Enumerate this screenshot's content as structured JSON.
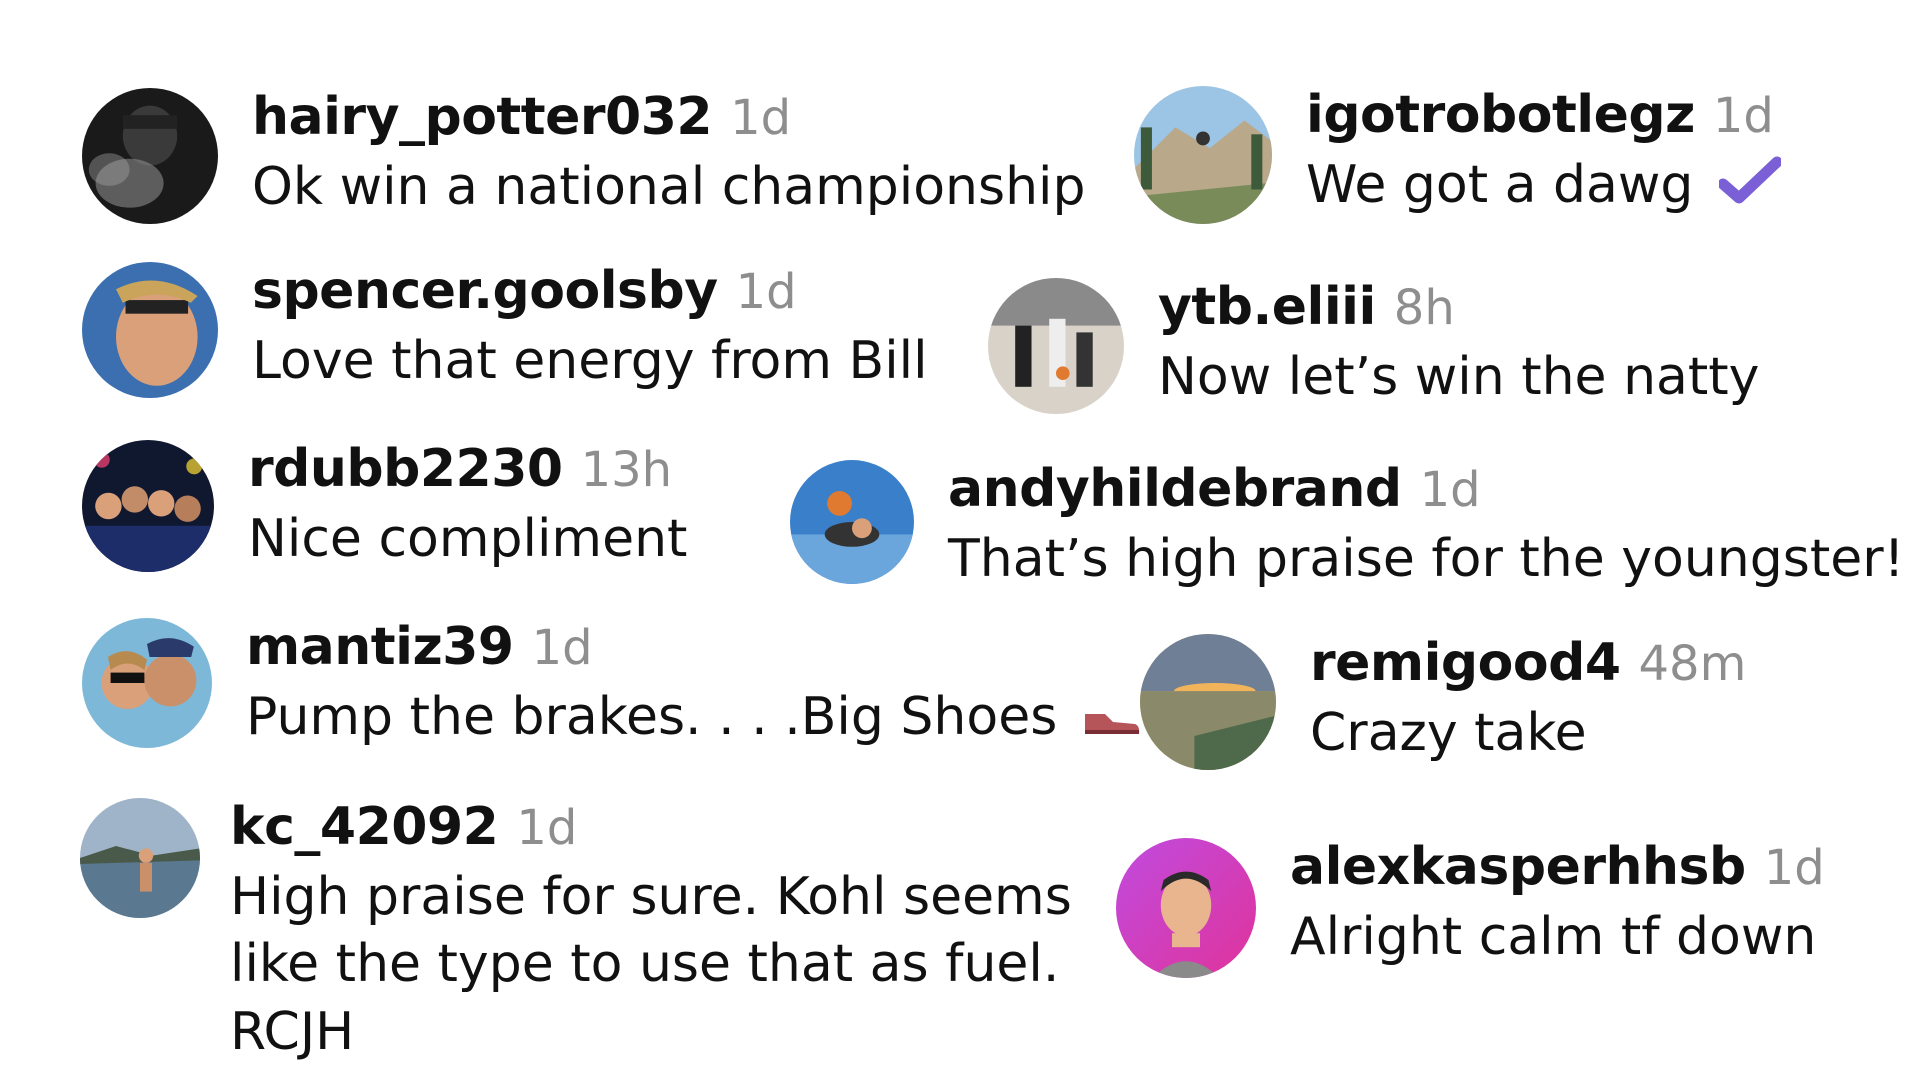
{
  "comments": [
    {
      "username": "hairy_potter032",
      "time": "1d",
      "text": "Ok win a national championship",
      "avatar": "smoke-portrait"
    },
    {
      "username": "igotrobotlegz",
      "time": "1d",
      "text": "We got a dawg",
      "emoji": "check-mark-icon",
      "avatar": "biker-mountain"
    },
    {
      "username": "spencer.goolsby",
      "time": "1d",
      "text": "Love that energy from Bill",
      "avatar": "selfie-sunglasses"
    },
    {
      "username": "ytb.eliii",
      "time": "8h",
      "text": "Now let’s win the natty",
      "avatar": "basketball-gym"
    },
    {
      "username": "rdubb2230",
      "time": "13h",
      "text": "Nice compliment",
      "avatar": "team-photo"
    },
    {
      "username": "andyhildebrand",
      "time": "1d",
      "text": "That’s high praise for the youngster!",
      "avatar": "skydive"
    },
    {
      "username": "mantiz39",
      "time": "1d",
      "text": "Pump the brakes. . . .Big Shoes",
      "emoji": "shoe-icon",
      "avatar": "couple-selfie"
    },
    {
      "username": "remigood4",
      "time": "48m",
      "text": "Crazy take",
      "avatar": "sunset-field"
    },
    {
      "username": "kc_42092",
      "time": "1d",
      "text": "High praise for sure. Kohl seems like the type to use that as fuel. RCJH",
      "avatar": "lake-person"
    },
    {
      "username": "alexkasperhhsb",
      "time": "1d",
      "text": "Alright calm tf down",
      "avatar": "memoji-gradient"
    }
  ],
  "colors": {
    "username": "#111111",
    "timestamp": "#8e8e8e",
    "check_mark": "#7b5fd6",
    "shoe": "#b5555a"
  }
}
